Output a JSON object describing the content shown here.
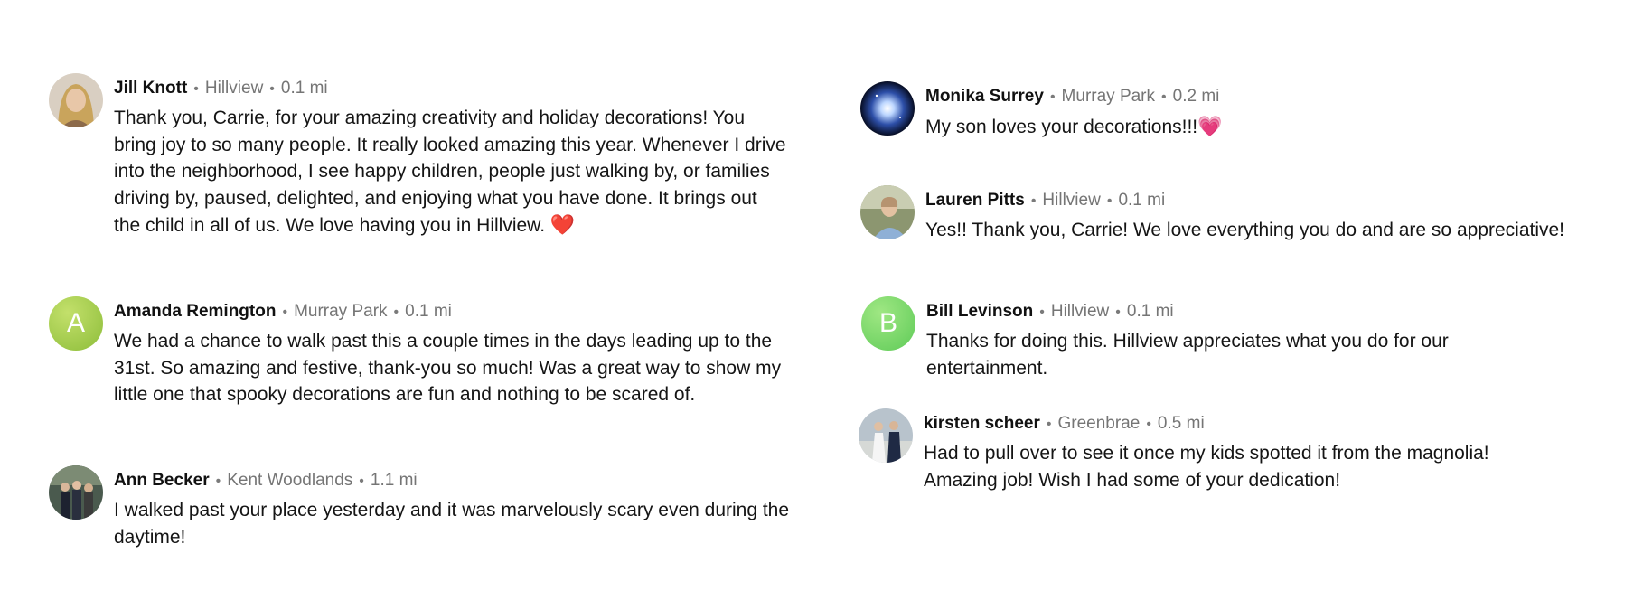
{
  "colors": {
    "letter_avatar_a": "#a9cf4e",
    "letter_avatar_b": "#7dd96c",
    "meta_gray": "#757575",
    "heart_red": "#e53935",
    "heart_pink": "#e46fb4"
  },
  "comments": [
    {
      "author": "Jill Knott",
      "neighborhood": "Hillview",
      "distance": "0.1 mi",
      "avatar_icon": "user-photo-avatar",
      "text": "Thank you, Carrie, for your amazing creativity and holiday decorations! You bring joy to so many people. It really looked amazing this year. Whenever I drive into the neighborhood, I see happy children, people just walking by, or families driving by, paused, delighted, and enjoying what you have done. It brings out the child in all of us. We love having you in Hillview.",
      "emoji": "❤️"
    },
    {
      "author": "Amanda Remington",
      "neighborhood": "Murray Park",
      "distance": "0.1 mi",
      "avatar_letter": "A",
      "text": "We had a chance to walk past this a couple times in the days leading up to the 31st. So amazing and festive, thank-you so much! Was a great way to show my little one that spooky decorations are fun and nothing to be scared of."
    },
    {
      "author": "Ann Becker",
      "neighborhood": "Kent Woodlands",
      "distance": "1.1 mi",
      "avatar_icon": "group-photo-avatar",
      "text": "I walked past your place yesterday and it was marvelously scary even during the daytime!"
    },
    {
      "author": "Monika Surrey",
      "neighborhood": "Murray Park",
      "distance": "0.2 mi",
      "avatar_icon": "galaxy-photo-avatar",
      "text": "My son loves your decorations!!!",
      "emoji": "💗"
    },
    {
      "author": "Lauren Pitts",
      "neighborhood": "Hillview",
      "distance": "0.1 mi",
      "avatar_icon": "user-photo-avatar",
      "text": "Yes!! Thank you, Carrie! We love everything you do and are so appreciative!"
    },
    {
      "author": "Bill Levinson",
      "neighborhood": "Hillview",
      "distance": "0.1 mi",
      "avatar_letter": "B",
      "text": "Thanks for doing this. Hillview appreciates what you do for our entertainment."
    },
    {
      "author": "kirsten scheer",
      "neighborhood": "Greenbrae",
      "distance": "0.5 mi",
      "avatar_icon": "couple-photo-avatar",
      "text": "Had to pull over to see it once my kids spotted it from the magnolia! Amazing job! Wish I had some of your dedication!"
    }
  ]
}
